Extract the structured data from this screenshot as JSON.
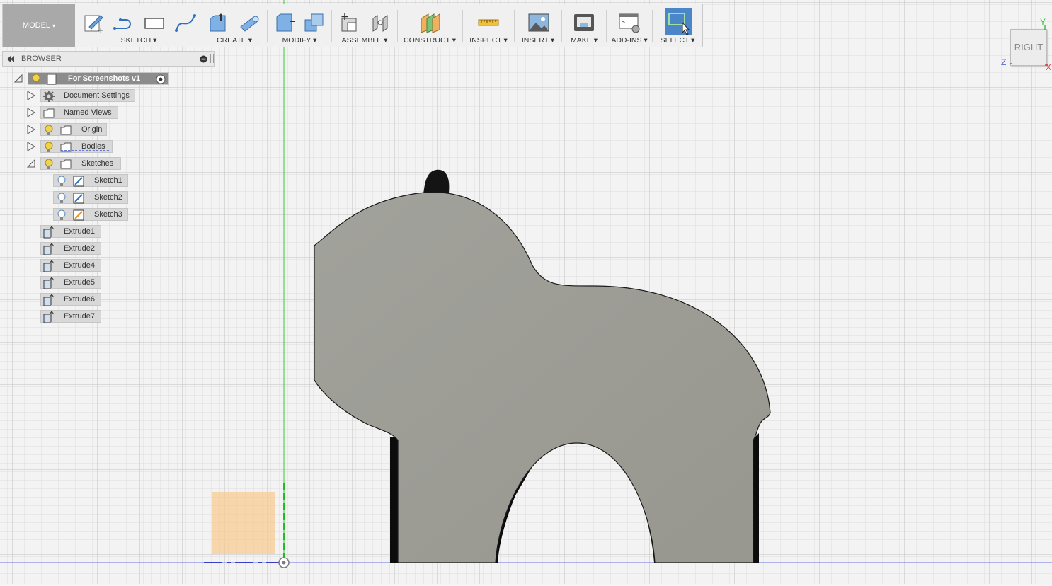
{
  "toolbar": {
    "workspace": "MODEL",
    "groups": [
      {
        "label": "SKETCH"
      },
      {
        "label": "CREATE"
      },
      {
        "label": "MODIFY"
      },
      {
        "label": "ASSEMBLE"
      },
      {
        "label": "CONSTRUCT"
      },
      {
        "label": "INSPECT"
      },
      {
        "label": "INSERT"
      },
      {
        "label": "MAKE"
      },
      {
        "label": "ADD-INS"
      },
      {
        "label": "SELECT"
      }
    ],
    "dropdown_arrow": "▾"
  },
  "browser": {
    "title": "BROWSER",
    "root": "For Screenshots v1",
    "items": [
      {
        "label": "Document Settings",
        "icon": "gear-icon"
      },
      {
        "label": "Named Views",
        "icon": "folder-icon"
      },
      {
        "label": "Origin",
        "icon": "folder-icon"
      },
      {
        "label": "Bodies",
        "icon": "folder-icon"
      },
      {
        "label": "Sketches",
        "icon": "folder-icon"
      }
    ],
    "sketches": [
      {
        "label": "Sketch1"
      },
      {
        "label": "Sketch2"
      },
      {
        "label": "Sketch3"
      }
    ],
    "features": [
      {
        "label": "Extrude1"
      },
      {
        "label": "Extrude2"
      },
      {
        "label": "Extrude4"
      },
      {
        "label": "Extrude5"
      },
      {
        "label": "Extrude6"
      },
      {
        "label": "Extrude7"
      }
    ]
  },
  "viewcube": {
    "face": "RIGHT",
    "axes": {
      "y": "Y",
      "z": "Z",
      "x": "X"
    }
  },
  "colors": {
    "toolbar_bg": "#f0f0f0",
    "model_button": "#a9a9a9",
    "select_active": "#4a86c8",
    "body_fill": "#9a9a92",
    "grid_minor": "#dcdcdc",
    "grid_major": "#c4c4c4",
    "origin_plane": "#f5d6a0",
    "y_axis": "#33cc33",
    "x_axis": "#4a56d8"
  }
}
